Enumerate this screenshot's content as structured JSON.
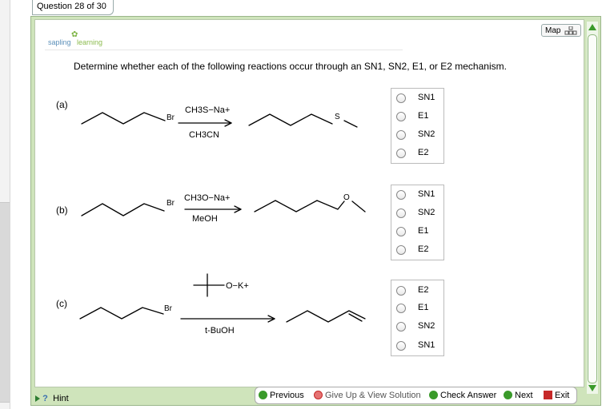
{
  "header": {
    "tab_title": "Question 28 of 30",
    "map_label": "Map"
  },
  "brand": {
    "logo_part1": "sapling",
    "logo_part2": "learning"
  },
  "question": {
    "prompt": "Determine whether each of the following reactions occur through an SN1, SN2, E1, or E2 mechanism."
  },
  "reactions": [
    {
      "label": "(a)",
      "leaving_group": "Br",
      "reagent": "CH3S−Na+",
      "solvent": "CH3CN",
      "product_heteroatom": "S",
      "options": [
        "SN1",
        "E1",
        "SN2",
        "E2"
      ]
    },
    {
      "label": "(b)",
      "leaving_group": "Br",
      "reagent": "CH3O−Na+",
      "solvent": "MeOH",
      "product_heteroatom": "O",
      "options": [
        "SN1",
        "SN2",
        "E1",
        "E2"
      ]
    },
    {
      "label": "(c)",
      "leaving_group": "Br",
      "reagent": "O−K+",
      "solvent": "t-BuOH",
      "options": [
        "E2",
        "E1",
        "SN2",
        "SN1"
      ]
    }
  ],
  "footer": {
    "hint": "Hint",
    "previous": "Previous",
    "give_up": "Give Up & View Solution",
    "check": "Check Answer",
    "next": "Next",
    "exit": "Exit"
  },
  "colors": {
    "frame": "#cfe4bb",
    "accent_green": "#3a9a2a",
    "logo_blue": "#5b8fb9",
    "logo_green": "#8cbb4e"
  },
  "icons": [
    "map-icon",
    "scroll-up-arrow",
    "scroll-down-arrow",
    "hint-icon",
    "previous-icon",
    "give-up-icon",
    "check-icon",
    "next-icon",
    "exit-icon"
  ]
}
